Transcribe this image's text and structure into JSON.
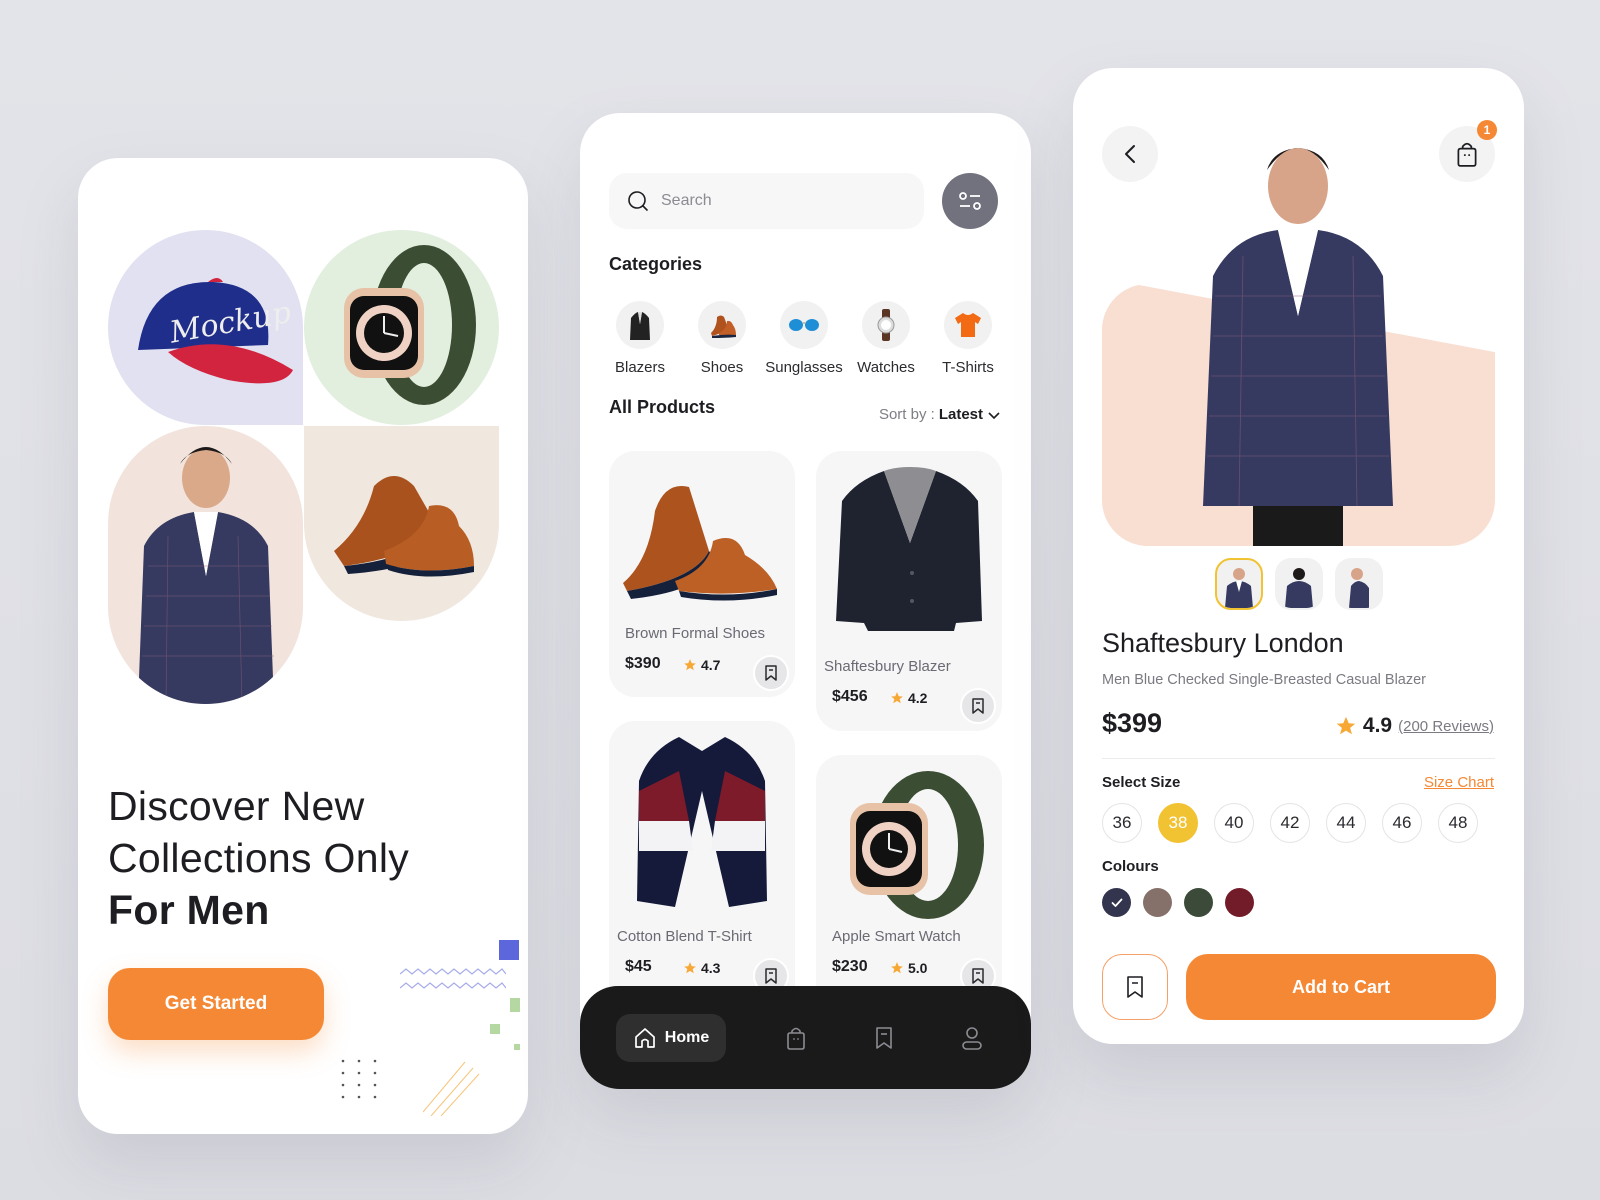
{
  "onboarding": {
    "headline_line1": "Discover New",
    "headline_line2": "Collections Only",
    "headline_bold": "For Men",
    "cta_label": "Get Started",
    "featured_items": [
      "cap",
      "smart-watch",
      "blazer-model",
      "formal-shoes"
    ]
  },
  "browse": {
    "search": {
      "placeholder": "Search",
      "value": ""
    },
    "categories_title": "Categories",
    "categories": [
      {
        "label": "Blazers",
        "icon": "blazer-icon"
      },
      {
        "label": "Shoes",
        "icon": "shoe-icon"
      },
      {
        "label": "Sunglasses",
        "icon": "sunglasses-icon"
      },
      {
        "label": "Watches",
        "icon": "watch-icon"
      },
      {
        "label": "T-Shirts",
        "icon": "tshirt-icon"
      }
    ],
    "products_title": "All Products",
    "sort_label": "Sort by :",
    "sort_value": "Latest",
    "products": [
      {
        "name": "Brown Formal Shoes",
        "price": "$390",
        "rating": "4.7"
      },
      {
        "name": "Shaftesbury Blazer",
        "price": "$456",
        "rating": "4.2"
      },
      {
        "name": "Cotton Blend T-Shirt",
        "price": "$45",
        "rating": "4.3"
      },
      {
        "name": "Apple Smart Watch",
        "price": "$230",
        "rating": "5.0"
      }
    ],
    "tabbar": {
      "active_label": "Home",
      "tabs": [
        "home-icon",
        "bag-icon",
        "bookmark-icon",
        "profile-icon"
      ]
    }
  },
  "detail": {
    "cart_count": "1",
    "title": "Shaftesbury London",
    "subtitle": "Men Blue Checked Single-Breasted Casual Blazer",
    "price": "$399",
    "rating": "4.9",
    "reviews": "(200 Reviews)",
    "select_size_label": "Select Size",
    "size_chart_label": "Size Chart",
    "sizes": [
      "36",
      "38",
      "40",
      "42",
      "44",
      "46",
      "48"
    ],
    "selected_size": "38",
    "colours_label": "Colours",
    "colours": [
      "#33354f",
      "#86716a",
      "#3b4a39",
      "#731c29"
    ],
    "selected_colour": "#33354f",
    "add_to_cart_label": "Add to Cart"
  },
  "theme": {
    "accent": "#f58834",
    "highlight": "#f1c232",
    "dark": "#1a1a1a",
    "star": "#f7a733"
  }
}
